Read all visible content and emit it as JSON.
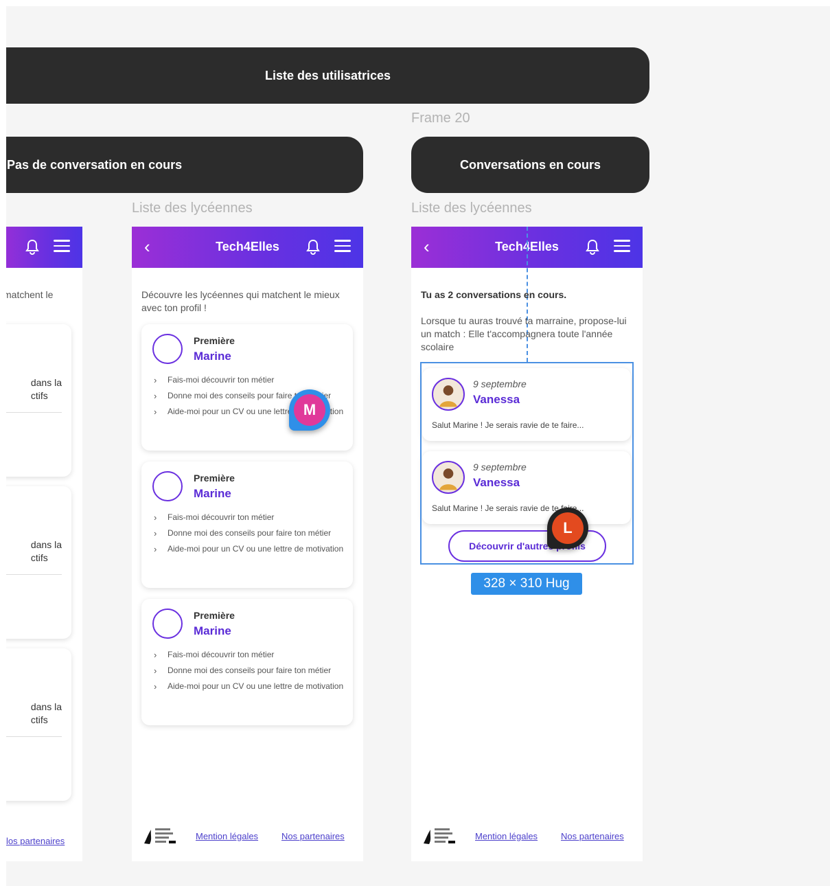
{
  "top_bar": {
    "label": "Liste des utilisatrices"
  },
  "frame20": {
    "label": "Frame 20"
  },
  "section_left": {
    "label": "Pas de conversation en cours"
  },
  "section_right": {
    "label": "Conversations en cours"
  },
  "frame_labels": {
    "middle": "Liste des lycéennes",
    "right": "Liste des lycéennes"
  },
  "app": {
    "title": "Tech4Elles"
  },
  "left_phone": {
    "intro_partial": "matchent le",
    "card_fragment_1": "dans la",
    "card_fragment_2": "ctifs",
    "footer_link": "los partenaires"
  },
  "middle_phone": {
    "intro": "Découvre les lycéennes qui matchent le mieux avec ton profil !",
    "cards": [
      {
        "level": "Première",
        "name": "Marine",
        "items": [
          "Fais-moi découvrir ton métier",
          "Donne moi des conseils pour faire ton métier",
          "Aide-moi pour un CV ou une lettre de motivation"
        ]
      },
      {
        "level": "Première",
        "name": "Marine",
        "items": [
          "Fais-moi découvrir ton métier",
          "Donne moi des conseils pour faire ton métier",
          "Aide-moi pour un CV ou une lettre de motivation"
        ]
      },
      {
        "level": "Première",
        "name": "Marine",
        "items": [
          "Fais-moi découvrir ton métier",
          "Donne moi des conseils pour faire ton métier",
          "Aide-moi pour un CV ou une lettre de motivation"
        ]
      }
    ]
  },
  "right_phone": {
    "heading": "Tu as 2 conversations en cours.",
    "description": "Lorsque tu auras trouvé ta marraine, propose-lui un match : Elle t'accompagnera toute l'année scolaire",
    "conversations": [
      {
        "date": "9 septembre",
        "name": "Vanessa",
        "message": "Salut Marine ! Je serais ravie de te faire..."
      },
      {
        "date": "9 septembre",
        "name": "Vanessa",
        "message": "Salut Marine ! Je serais ravie de te faire..."
      }
    ],
    "discover_button": "Découvrir d'autres profils",
    "selection_size": "328 × 310 Hug"
  },
  "footer": {
    "legal": "Mention légales",
    "partners": "Nos partenaires"
  },
  "cursors": {
    "m": "M",
    "l": "L"
  },
  "colors": {
    "accent": "#6a30e0",
    "header_start": "#9b2fd6",
    "header_end": "#4d34e6",
    "selection": "#4a90e2"
  }
}
